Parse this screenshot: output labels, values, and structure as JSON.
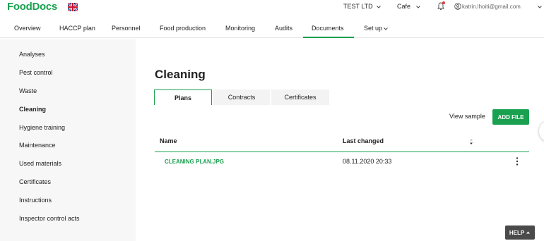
{
  "brand": {
    "logo": "FoodDocs"
  },
  "topbar": {
    "company": "TEST LTD",
    "location": "Cafe",
    "email": "katrin.lhoiti@gmail.com"
  },
  "nav": {
    "tabs": [
      {
        "label": "Overview"
      },
      {
        "label": "HACCP plan"
      },
      {
        "label": "Personnel"
      },
      {
        "label": "Food production"
      },
      {
        "label": "Monitoring"
      },
      {
        "label": "Audits"
      },
      {
        "label": "Documents"
      },
      {
        "label": "Set up"
      }
    ],
    "active": "Documents"
  },
  "sidebar": {
    "items": [
      {
        "label": "Analyses"
      },
      {
        "label": "Pest control"
      },
      {
        "label": "Waste"
      },
      {
        "label": "Cleaning"
      },
      {
        "label": "Hygiene training"
      },
      {
        "label": "Maintenance"
      },
      {
        "label": "Used materials"
      },
      {
        "label": "Certificates"
      },
      {
        "label": "Instructions"
      },
      {
        "label": "Inspector control acts"
      }
    ],
    "active": "Cleaning"
  },
  "page": {
    "title": "Cleaning",
    "subtabs": [
      {
        "label": "Plans"
      },
      {
        "label": "Contracts"
      },
      {
        "label": "Certificates"
      }
    ],
    "active_subtab": "Plans",
    "view_sample": "View sample",
    "add_file": "ADD FILE"
  },
  "table": {
    "columns": [
      "Name",
      "Last changed"
    ],
    "rows": [
      {
        "name": "CLEANING PLAN.JPG",
        "last_changed": "08.11.2020 20:33"
      }
    ]
  },
  "help": {
    "label": "HELP"
  },
  "colors": {
    "accent": "#1aa150",
    "sidebar_bg": "#f7f7f7",
    "help_bg": "#4a4a4a"
  }
}
